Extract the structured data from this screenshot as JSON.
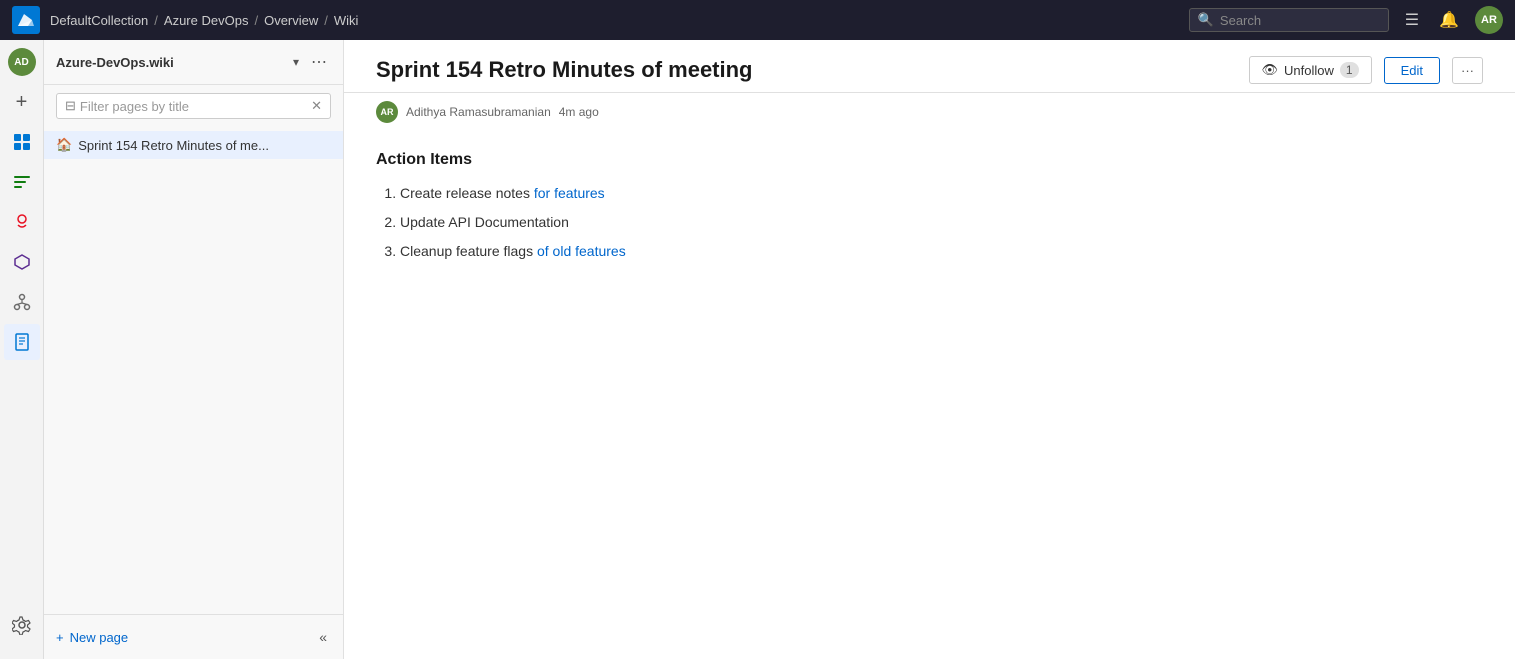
{
  "topnav": {
    "logo_text": "Azure DevOps",
    "breadcrumbs": [
      {
        "label": "DefaultCollection"
      },
      {
        "label": "Azure DevOps"
      },
      {
        "label": "Overview"
      },
      {
        "label": "Wiki"
      }
    ],
    "search_placeholder": "Search",
    "avatar_initials": "AR"
  },
  "icon_sidebar": {
    "top_avatar_initials": "AD",
    "add_label": "+",
    "icons": [
      {
        "name": "boards-icon",
        "symbol": "⊞"
      },
      {
        "name": "sprints-icon",
        "symbol": "⊟"
      },
      {
        "name": "artifacts-icon",
        "symbol": "◈"
      },
      {
        "name": "test-plans-icon",
        "symbol": "⬡"
      },
      {
        "name": "repos-icon",
        "symbol": "⌥"
      },
      {
        "name": "wiki-icon",
        "symbol": "📄",
        "active": true
      }
    ],
    "settings_icon": "⚙"
  },
  "page_sidebar": {
    "wiki_title": "Azure-DevOps.wiki",
    "filter_placeholder": "Filter pages by title",
    "pages": [
      {
        "label": "Sprint 154 Retro Minutes of me...",
        "icon": "🏠"
      }
    ],
    "new_page_label": "New page",
    "collapse_icon": "«"
  },
  "content": {
    "page_title": "Sprint 154 Retro Minutes of meeting",
    "author_initials": "AR",
    "author_name": "Adithya Ramasubramanian",
    "time_ago": "4m ago",
    "unfollow_label": "Unfollow",
    "follower_count": "1",
    "edit_label": "Edit",
    "more_label": "···",
    "section_heading": "Action Items",
    "action_items": [
      {
        "text": "Create release notes for features"
      },
      {
        "text": "Update API Documentation"
      },
      {
        "text": "Cleanup feature flags of old features"
      }
    ]
  }
}
